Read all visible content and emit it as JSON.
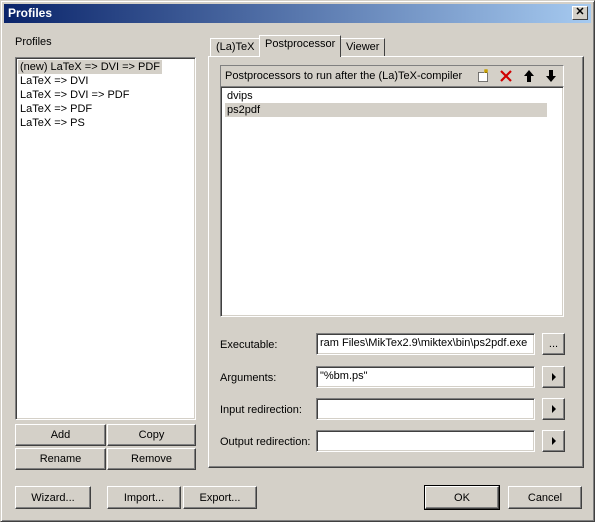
{
  "window": {
    "title": "Profiles"
  },
  "profiles": {
    "label": "Profiles",
    "items": [
      {
        "label": "(new) LaTeX => DVI => PDF"
      },
      {
        "label": "LaTeX => DVI"
      },
      {
        "label": "LaTeX => DVI => PDF"
      },
      {
        "label": "LaTeX => PDF"
      },
      {
        "label": "LaTeX => PS"
      }
    ],
    "selected_index": 0,
    "buttons": {
      "add": "Add",
      "copy": "Copy",
      "rename": "Rename",
      "remove": "Remove"
    }
  },
  "tabs": [
    {
      "label": "(La)TeX"
    },
    {
      "label": "Postprocessor"
    },
    {
      "label": "Viewer"
    }
  ],
  "active_tab": "Postprocessor",
  "postprocessor": {
    "header": "Postprocessors to run after the (La)TeX-compiler",
    "toolbar_icons": [
      "new-icon",
      "delete-icon",
      "move-up-icon",
      "move-down-icon"
    ],
    "items": [
      {
        "label": "dvips"
      },
      {
        "label": "ps2pdf"
      }
    ],
    "selected_index": 1,
    "fields": {
      "executable": {
        "label": "Executable:",
        "value": "ram Files\\MikTex2.9\\miktex\\bin\\ps2pdf.exe",
        "button": "..."
      },
      "arguments": {
        "label": "Arguments:",
        "value": "\"%bm.ps\""
      },
      "input_redirection": {
        "label": "Input redirection:",
        "value": ""
      },
      "output_redirection": {
        "label": "Output redirection:",
        "value": ""
      }
    }
  },
  "footer": {
    "wizard": "Wizard...",
    "import": "Import...",
    "export": "Export...",
    "ok": "OK",
    "cancel": "Cancel"
  }
}
